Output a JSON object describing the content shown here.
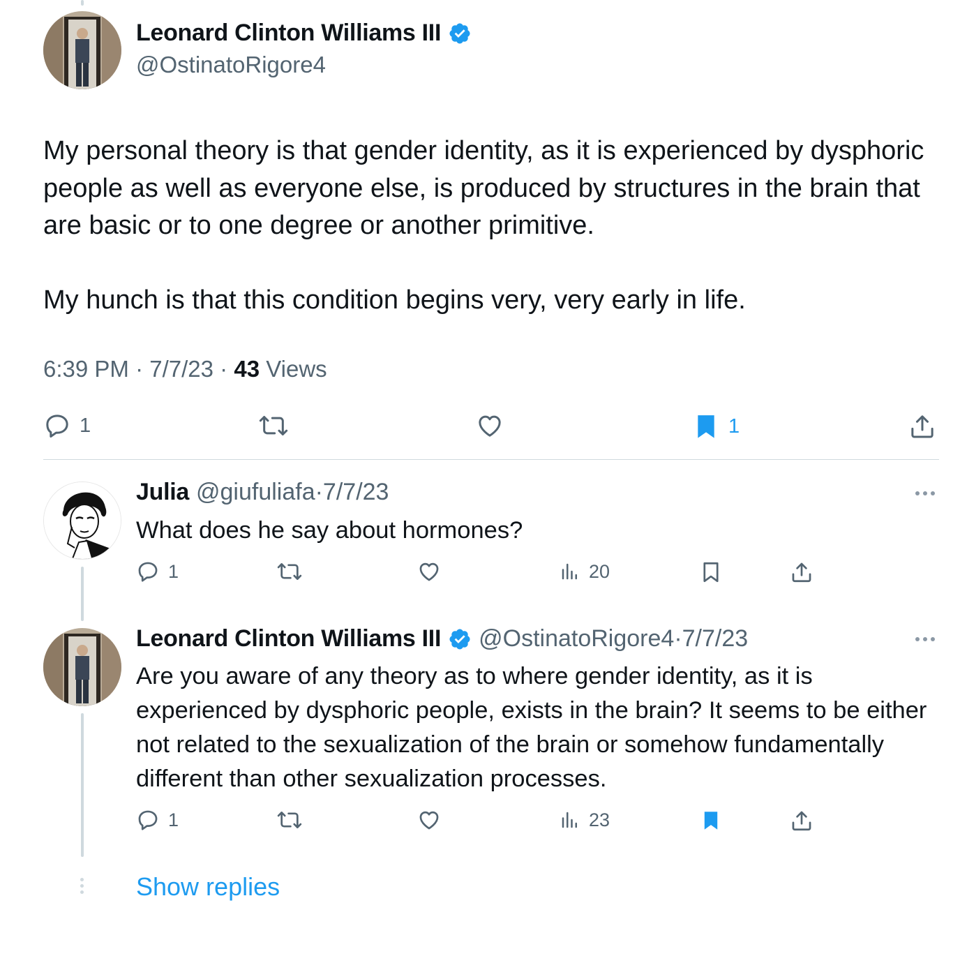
{
  "colors": {
    "accent": "#1d9bf0",
    "verified": "#1d9bf0",
    "secondary_text": "#536471",
    "thread_line": "#cfd9de"
  },
  "main_tweet": {
    "author_name": "Leonard Clinton Williams III",
    "handle": "@OstinatoRigore4",
    "paragraph_1": "My personal theory is that gender identity, as it is experienced by dysphoric people as well as everyone else, is produced by structures in the brain that are basic or to one degree or another primitive.",
    "paragraph_2": "My hunch is that this condition begins very, very early in life.",
    "time": "6:39 PM",
    "sep": "·",
    "date": "7/7/23",
    "views_count": "43",
    "views_label": "Views",
    "actions": {
      "reply_count": "1",
      "bookmark_count": "1"
    }
  },
  "replies": [
    {
      "author_name": "Julia",
      "handle": "@giufuliafa",
      "date_sep": "·7/7/23",
      "text": "What does he say about hormones?",
      "reply_count": "1",
      "views_count": "20"
    },
    {
      "author_name": "Leonard Clinton Williams III",
      "handle": "@OstinatoRigore4",
      "date_sep": "·7/7/23",
      "text": "Are you aware of any theory as to where gender identity, as it is experienced by dysphoric people, exists in the brain? It seems to be either not related to the sexualization of the brain or somehow fundamentally different than other sexualization processes.",
      "reply_count": "1",
      "views_count": "23"
    }
  ],
  "show_replies_label": "Show replies",
  "icons": [
    "reply-icon",
    "retweet-icon",
    "like-icon",
    "bookmark-icon",
    "share-icon",
    "views-icon",
    "verified-badge-icon",
    "more-icon"
  ]
}
